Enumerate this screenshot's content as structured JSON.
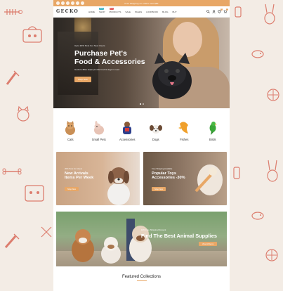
{
  "topbar": {
    "promo": "Free Shipping on orders over $50",
    "social_icons": [
      "facebook-icon",
      "twitter-icon",
      "instagram-icon",
      "pinterest-icon",
      "youtube-icon",
      "tumblr-icon"
    ]
  },
  "header": {
    "logo": "GECKO",
    "nav": [
      {
        "label": "Home"
      },
      {
        "label": "Shop",
        "badge": "New"
      },
      {
        "label": "Products",
        "badge": "Hot"
      },
      {
        "label": "Sale"
      },
      {
        "label": "Pages"
      },
      {
        "label": "Lookbook"
      },
      {
        "label": "Blog"
      },
      {
        "label": "Buy"
      }
    ],
    "icons": [
      "search-icon",
      "user-icon",
      "heart-icon",
      "cart-icon"
    ],
    "wishlist_count": "0",
    "cart_count": "0"
  },
  "hero": {
    "kicker": "Upto 20% Pets For New Users",
    "title_line1": "Purchase Pet's",
    "title_line2": "Food & Accessories",
    "subtitle": "Gecko's Bliss helps provide food & dogs in need",
    "button": "Shop Now"
  },
  "categories": [
    {
      "label": "Cats"
    },
    {
      "label": "Small Pets"
    },
    {
      "label": "Accessories"
    },
    {
      "label": "Dogs"
    },
    {
      "label": "Fishes"
    },
    {
      "label": "Birds"
    }
  ],
  "banner_left": {
    "kicker": "20% Pets For Users",
    "title_line1": "New Arrivals",
    "title_line2": "Items Per Week",
    "button": "Shop Now"
  },
  "banner_right": {
    "kicker": "Free Shipping Available",
    "title_line1": "Popular Toys",
    "title_line2": "Accessories -30%",
    "button": "Shop Now"
  },
  "wide_banner": {
    "kicker": "10% Free Shipping Discount",
    "title": "Find The Best Animal Supplies",
    "button": "View All Items"
  },
  "featured": {
    "title": "Featured Collections"
  },
  "colors": {
    "accent": "#e8a766",
    "doodle": "#d96a5a",
    "background": "#f3ece5"
  }
}
